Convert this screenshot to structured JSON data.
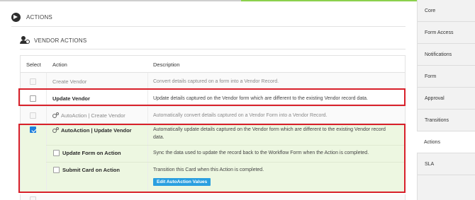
{
  "section": {
    "title": "ACTIONS"
  },
  "subsection": {
    "title": "VENDOR ACTIONS"
  },
  "table": {
    "headers": {
      "select": "Select",
      "action": "Action",
      "description": "Description"
    },
    "rows": [
      {
        "action": "Create Vendor",
        "description": "Convert details captured on a form into a Vendor Record.",
        "checked": false,
        "disabled": true
      },
      {
        "action": "Update Vendor",
        "description": "Update details captured on the Vendor form which are different to the existing Vendor record data.",
        "checked": false,
        "disabled": false
      },
      {
        "action": "AutoAction | Create Vendor",
        "description": "Automatically convert details captured on a Vendor Form into a Vendor Record.",
        "checked": false,
        "disabled": true
      },
      {
        "action": "AutoAction | Update Vendor",
        "description": "Automatically update details captured on the Vendor form which are different to the existing Vendor record data.",
        "checked": true,
        "disabled": false
      }
    ],
    "sub_options": [
      {
        "label": "Update Form on Action",
        "description": "Sync the data used to update the record back to the Workflow Form when the Action is completed.",
        "checked": false
      },
      {
        "label": "Submit Card on Action",
        "description": "Transition this Card when this Action is completed.",
        "checked": false
      }
    ],
    "edit_button": "Edit AutoAction Values"
  },
  "sidebar": {
    "tabs": [
      "Core",
      "Form Access",
      "Notifications",
      "Form",
      "Approval",
      "Transitions",
      "Actions",
      "SLA"
    ],
    "active": "Actions"
  },
  "colors": {
    "highlight": "#d8202a",
    "accent": "#2a9fe0",
    "green_bg": "#edf7e1"
  }
}
